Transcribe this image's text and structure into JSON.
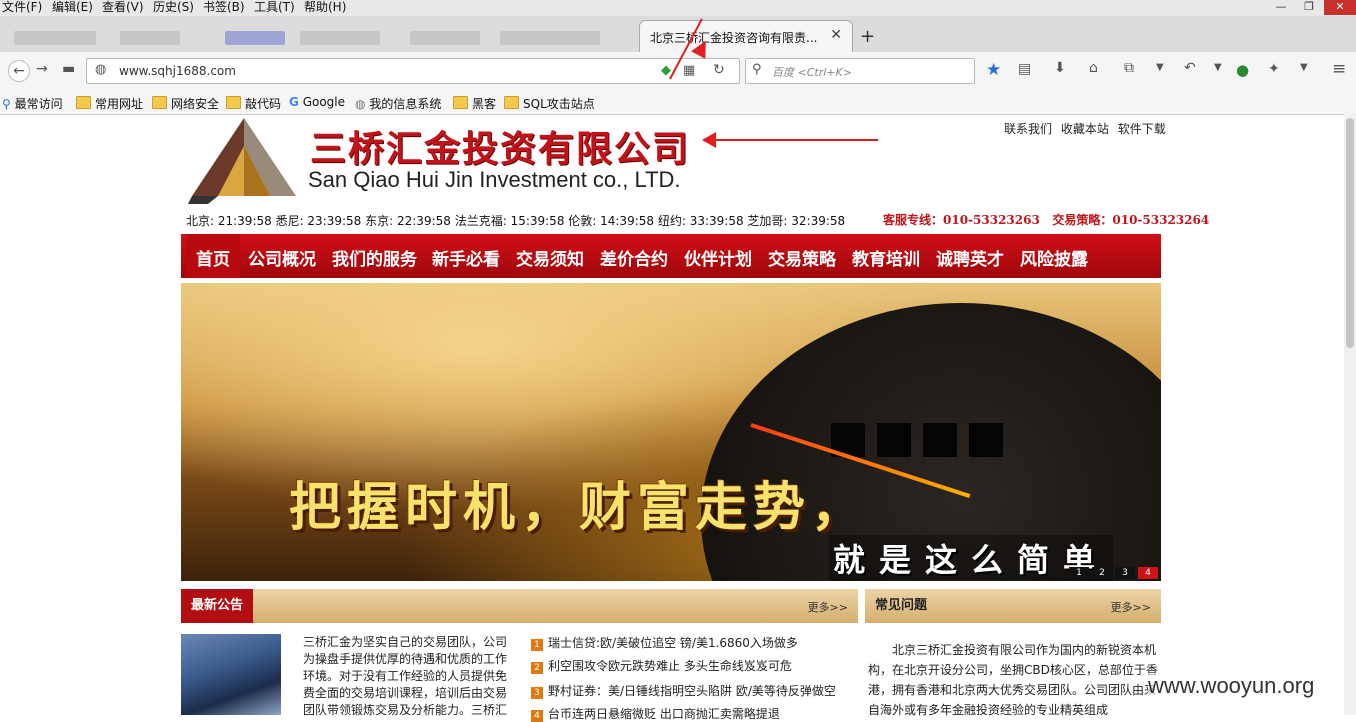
{
  "browser": {
    "menu": [
      "文件(F)",
      "编辑(E)",
      "查看(V)",
      "历史(S)",
      "书签(B)",
      "工具(T)",
      "帮助(H)"
    ],
    "window_controls": {
      "minimize": "—",
      "restore": "❐",
      "close": "✕"
    },
    "active_tab_title": "北京三桥汇金投资咨询有限责...",
    "tab_close": "✕",
    "new_tab": "+",
    "url": "www.sqhj1688.com",
    "search_placeholder": "百度 <Ctrl+K>",
    "bookmarks": [
      "最常访问",
      "常用网址",
      "网络安全",
      "敲代码",
      "Google",
      "我的信息系统",
      "黑客",
      "SQL攻击站点"
    ]
  },
  "site": {
    "name_cn": "三桥汇金投资有限公司",
    "name_en": "San Qiao Hui Jin Investment co., LTD.",
    "top_links": [
      "联系我们",
      "收藏本站",
      "软件下载"
    ],
    "clocks": "北京: 21:39:58  悉尼: 23:39:58  东京: 22:39:58  法兰克福: 15:39:58  伦敦: 14:39:58  纽约: 33:39:58  芝加哥: 32:39:58",
    "hotline": "客服专线：010-53323263",
    "strategy_line": "交易策略：010-53323264",
    "nav": [
      "首页",
      "公司概况",
      "我们的服务",
      "新手必看",
      "交易须知",
      "差价合约",
      "伙伴计划",
      "交易策略",
      "教育培训",
      "诚聘英才",
      "风险披露"
    ],
    "banner": {
      "slogan": "把握时机，财富走势，",
      "slogan2": "就是这么简单",
      "pages": [
        "1",
        "2",
        "3",
        "4"
      ]
    },
    "news": {
      "title": "最新公告",
      "more": "更多>>",
      "intro": "三桥汇金为坚实自己的交易团队，公司为操盘手提供优厚的待遇和优质的工作环境。对于没有工作经验的人员提供免费全面的交易培训课程，培训后由交易团队带领锻炼交易及分析能力。三桥汇",
      "headlines": [
        {
          "n": "1",
          "text": "瑞士信贷:欧/美破位追空 镑/美1.6860入场做多"
        },
        {
          "n": "2",
          "text": "利空围攻令欧元跌势难止 多头生命线岌岌可危"
        },
        {
          "n": "3",
          "text": "野村证券：美/日锤线指明空头陷阱 欧/美等待反弹做空"
        },
        {
          "n": "4",
          "text": "台币连两日悬缩微贬 出口商抛汇卖需略提退"
        }
      ]
    },
    "faq": {
      "title": "常见问题",
      "more": "更多>>",
      "text": "北京三桥汇金投资有限公司作为国内的新锐资本机构，在北京开设分公司，坐拥CBD核心区，总部位于香港，拥有香港和北京两大优秀交易团队。公司团队由来自海外或有多年金融投资经验的专业精英组成"
    },
    "watermark": "www.wooyun.org"
  },
  "colors": {
    "brand_red": "#c0141a",
    "nav_red": "#d10f17",
    "section_gold": "#d4ae6c"
  }
}
